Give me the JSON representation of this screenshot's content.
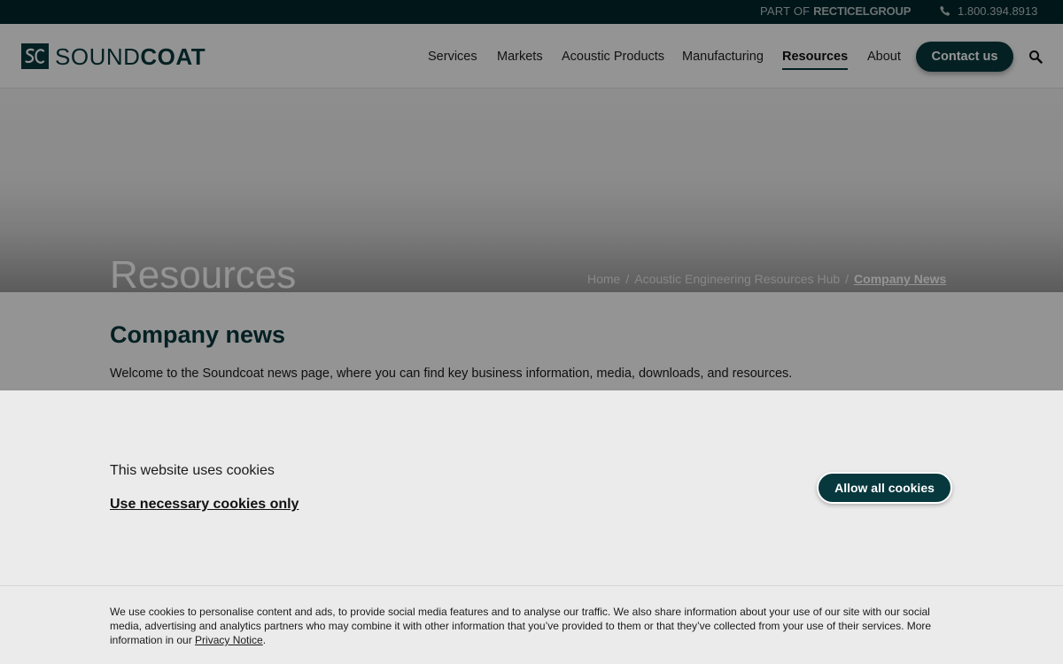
{
  "topbar": {
    "parent_prefix": "PART OF",
    "parent_brand": "RECTICELGROUP",
    "phone": "1.800.394.8913"
  },
  "header": {
    "logo": {
      "light": "SOUND",
      "bold": "COAT"
    },
    "nav": [
      "Services",
      "Markets",
      "Acoustic Products",
      "Manufacturing",
      "Resources",
      "About"
    ],
    "active_nav": "Resources",
    "contact_label": "Contact us"
  },
  "hero": {
    "title": "Resources",
    "breadcrumbs": [
      "Home",
      "Acoustic Engineering Resources Hub",
      "Company News"
    ]
  },
  "main": {
    "heading_light": "Company",
    "heading_bold": "news",
    "intro": "Welcome to the Soundcoat news page, where you can find key business information, media, downloads, and resources."
  },
  "cookie": {
    "title": "This website uses cookies",
    "necessary_label": "Use necessary cookies only",
    "allow_label": "Allow all cookies",
    "text_before": "We use cookies to personalise content and ads, to provide social media features and to analyse our traffic. We also share information about your use of our site with our social media, advertising and analytics partners who may combine it with other information that you’ve provided to them or that they’ve collected from your use of their services. More information in our ",
    "text_link": "Privacy Notice",
    "text_after": "."
  },
  "colors": {
    "brand": "#07383d",
    "topbar": "#00262b",
    "cookie_bg": "#ebebeb"
  }
}
